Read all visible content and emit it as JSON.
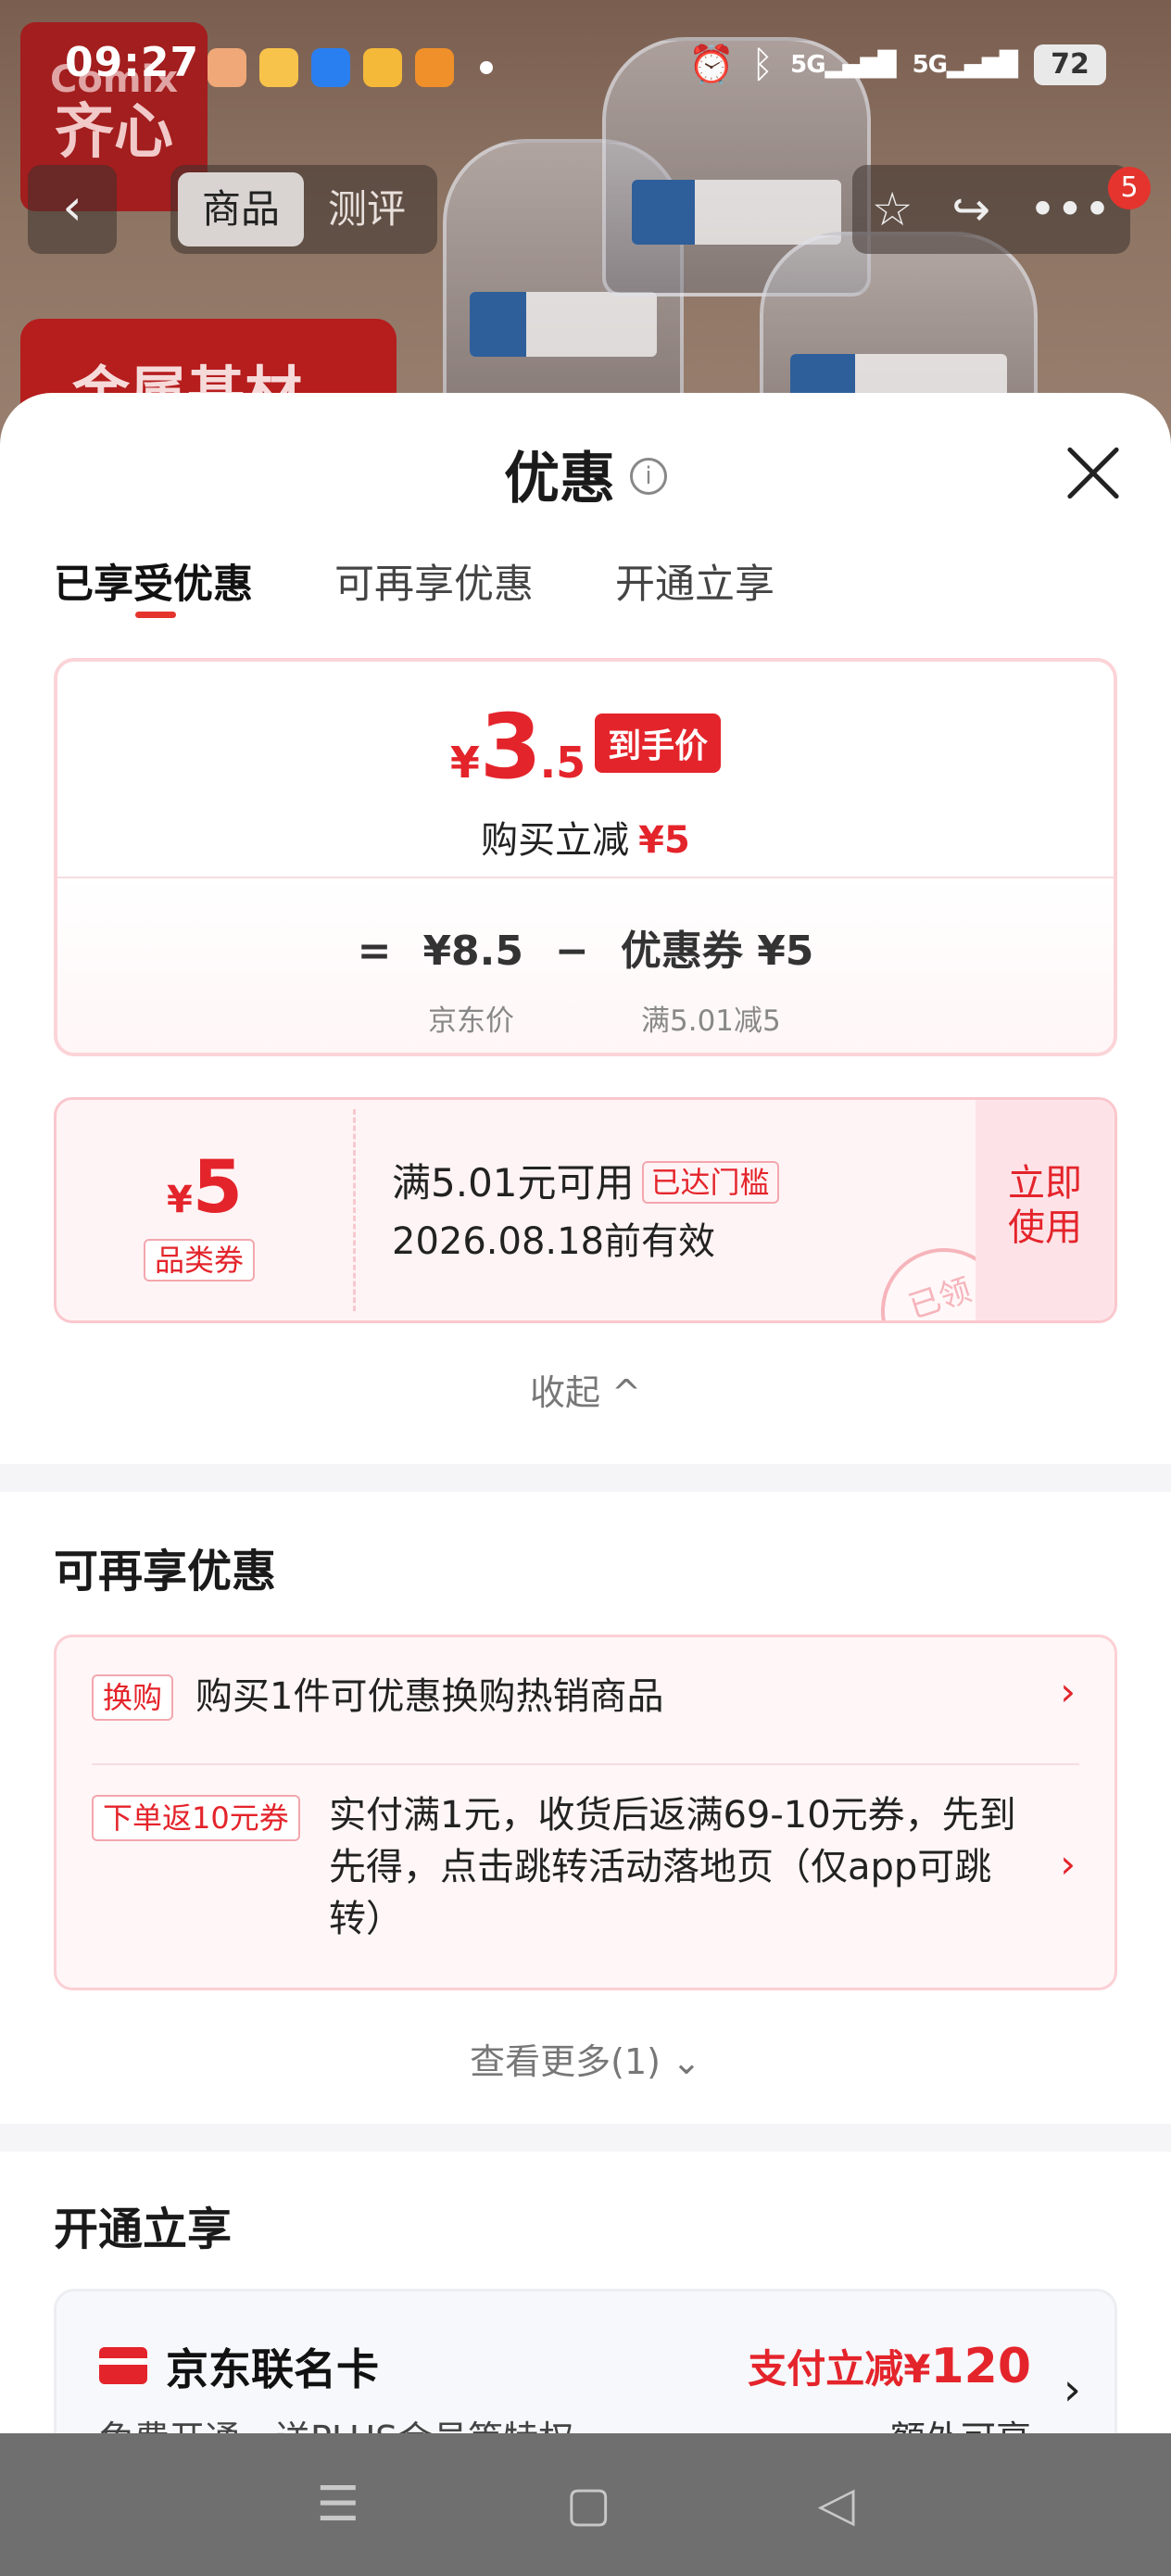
{
  "status_bar": {
    "time": "09:27",
    "signal_1": "5G",
    "signal_2": "5G",
    "battery": "72"
  },
  "background": {
    "brand_line1": "Comix",
    "brand_line2": "齐心",
    "promo_text": "金属基材",
    "back_icon": "chevron-left-icon",
    "nav_tabs": [
      {
        "label": "商品",
        "active": true
      },
      {
        "label": "测评",
        "active": false
      }
    ],
    "notification_count": "5"
  },
  "sheet": {
    "title": "优惠",
    "info_icon": "info-icon",
    "close_icon": "close-icon",
    "tabs": [
      {
        "label": "已享受优惠",
        "active": true
      },
      {
        "label": "可再享优惠",
        "active": false
      },
      {
        "label": "开通立享",
        "active": false
      }
    ],
    "price_card": {
      "currency": "¥",
      "price_int": "3",
      "price_dec": ".5",
      "final_tag": "到手价",
      "buy_label": "购买立减",
      "buy_amount": "¥5",
      "equals": "=",
      "jd_price": "¥8.5",
      "minus": "−",
      "coupon_label": "优惠券 ¥5",
      "jd_price_label": "京东价",
      "coupon_rule": "满5.01减5"
    },
    "coupon": {
      "currency": "¥",
      "value": "5",
      "type": "品类券",
      "condition": "满5.01元可用",
      "reached": "已达门槛",
      "expiry": "2026.08.18前有效",
      "use_line1": "立即",
      "use_line2": "使用",
      "stamp": "已领"
    },
    "collapse_label": "收起 ^",
    "reenjoy_title": "可再享优惠",
    "promos": [
      {
        "tag": "换购",
        "text": "购买1件可优惠换购热销商品"
      },
      {
        "tag": "下单返10元券",
        "text": "实付满1元，收货后返满69-10元券，先到先得，点击跳转活动落地页（仅app可跳转）"
      }
    ],
    "see_more": "查看更多(1) ⌄",
    "open_title": "开通立享",
    "card": {
      "name": "京东联名卡",
      "subtitle": "免费开通，送PLUS会员等特权",
      "benefit_prefix": "支付立减¥",
      "benefit_amount": "120",
      "extra": "额外可享"
    }
  },
  "colors": {
    "accent": "#e4242b",
    "card_border": "#fbd4d8",
    "coupon_bg": "#fff4f5"
  }
}
